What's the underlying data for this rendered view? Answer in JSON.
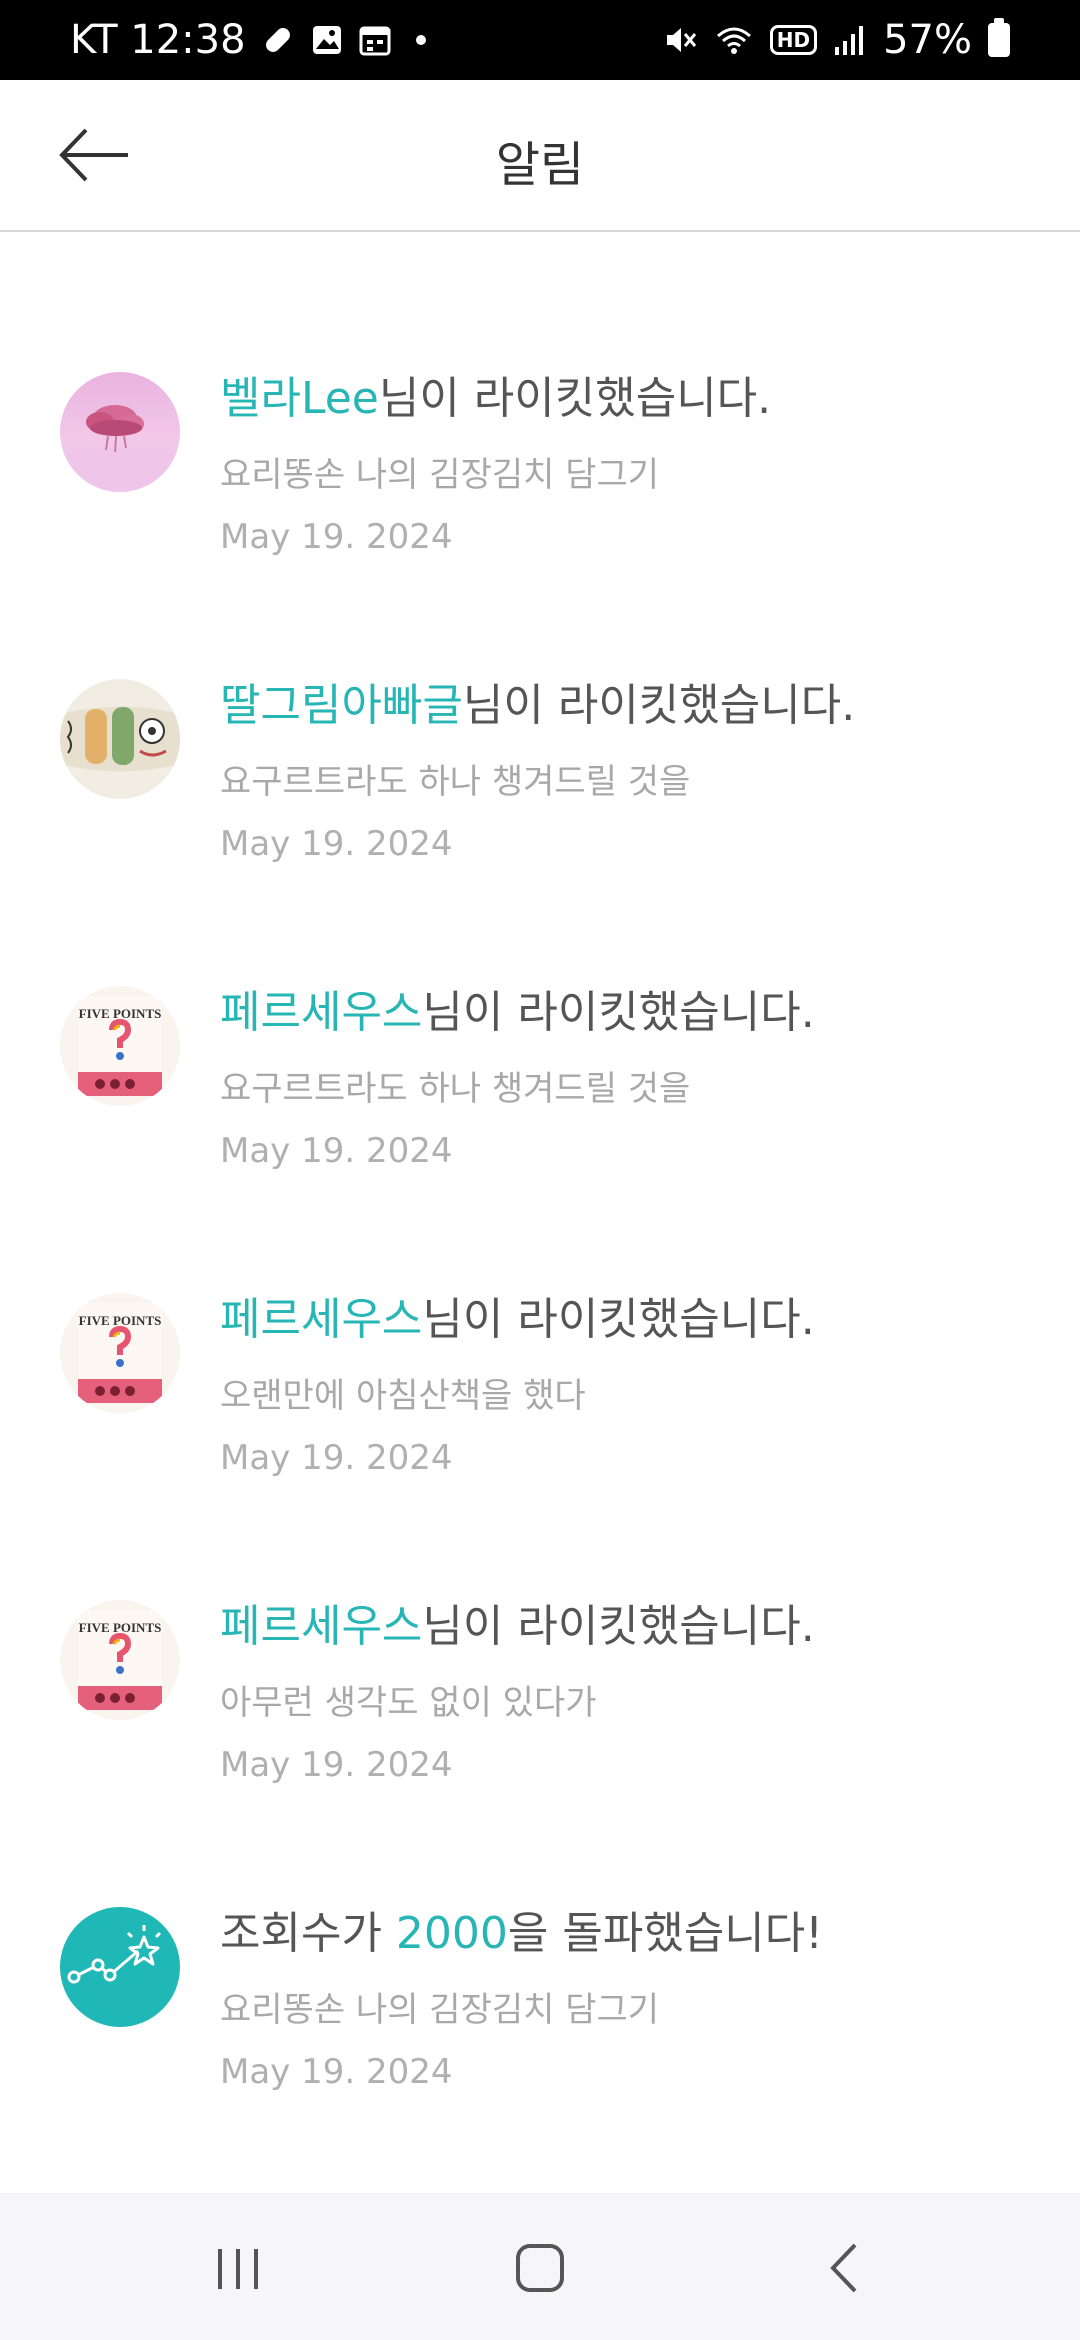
{
  "status_bar": {
    "carrier_time": "KT 12:38",
    "battery": "57%"
  },
  "header": {
    "title": "알림"
  },
  "notifications": [
    {
      "actor": "벨라Lee",
      "action": "님이 라이킷했습니다.",
      "subject": " 요리똥손 나의 김장김치 담그기",
      "date": "May 19. 2024"
    },
    {
      "actor": "딸그림아빠글",
      "action": "님이 라이킷했습니다.",
      "subject": "요구르트라도 하나 챙겨드릴 것을",
      "date": "May 19. 2024"
    },
    {
      "actor": "페르세우스",
      "action": "님이 라이킷했습니다.",
      "subject": "요구르트라도 하나 챙겨드릴 것을",
      "date": "May 19. 2024"
    },
    {
      "actor": "페르세우스",
      "action": "님이 라이킷했습니다.",
      "subject": "오랜만에 아침산책을 했다",
      "date": "May 19. 2024"
    },
    {
      "actor": "페르세우스",
      "action": "님이 라이킷했습니다.",
      "subject": "아무런 생각도 없이 있다가",
      "date": "May 19. 2024"
    },
    {
      "prefix": "조회수가 ",
      "highlight": "2000",
      "suffix": "을 돌파했습니다!",
      "subject": " 요리똥손 나의 김장김치 담그기",
      "date": "May 19. 2024"
    }
  ],
  "book_cover": {
    "title": "FIVE POINTS"
  },
  "colors": {
    "accent": "#27b6b4",
    "status_bar_bg": "#000000",
    "nav_bar_bg": "#f6f6f8"
  },
  "icons": {
    "back": "arrow-left-icon",
    "nav_recents": "recents-icon",
    "nav_home": "home-icon",
    "nav_back": "chevron-left-icon",
    "milestone": "star-graph-icon"
  }
}
